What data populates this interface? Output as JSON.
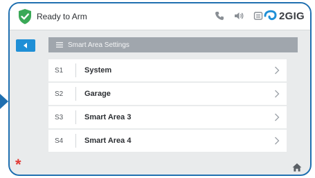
{
  "status_bar": {
    "title": "Ready to Arm",
    "shield_color": "#3aa957",
    "icons": [
      "phone-icon",
      "volume-icon",
      "message-icon"
    ],
    "brand": "2GIG",
    "brand_accent": "#1f8fd6"
  },
  "header": {
    "title": "Smart Area Settings",
    "icon": "list-icon"
  },
  "list": {
    "items": [
      {
        "number": "S1",
        "label": "System"
      },
      {
        "number": "S2",
        "label": "Garage"
      },
      {
        "number": "S3",
        "label": "Smart Area 3"
      },
      {
        "number": "S4",
        "label": "Smart Area 4"
      }
    ]
  },
  "bottom_bar": {
    "emergency_glyph": "*",
    "emergency_color": "#e23b36",
    "home_icon": "home-icon"
  },
  "colors": {
    "frame": "#1f6fb0",
    "back_button": "#1f8fd6",
    "header_bg": "#a0a6ad",
    "screen_bg": "#e9ebec"
  }
}
